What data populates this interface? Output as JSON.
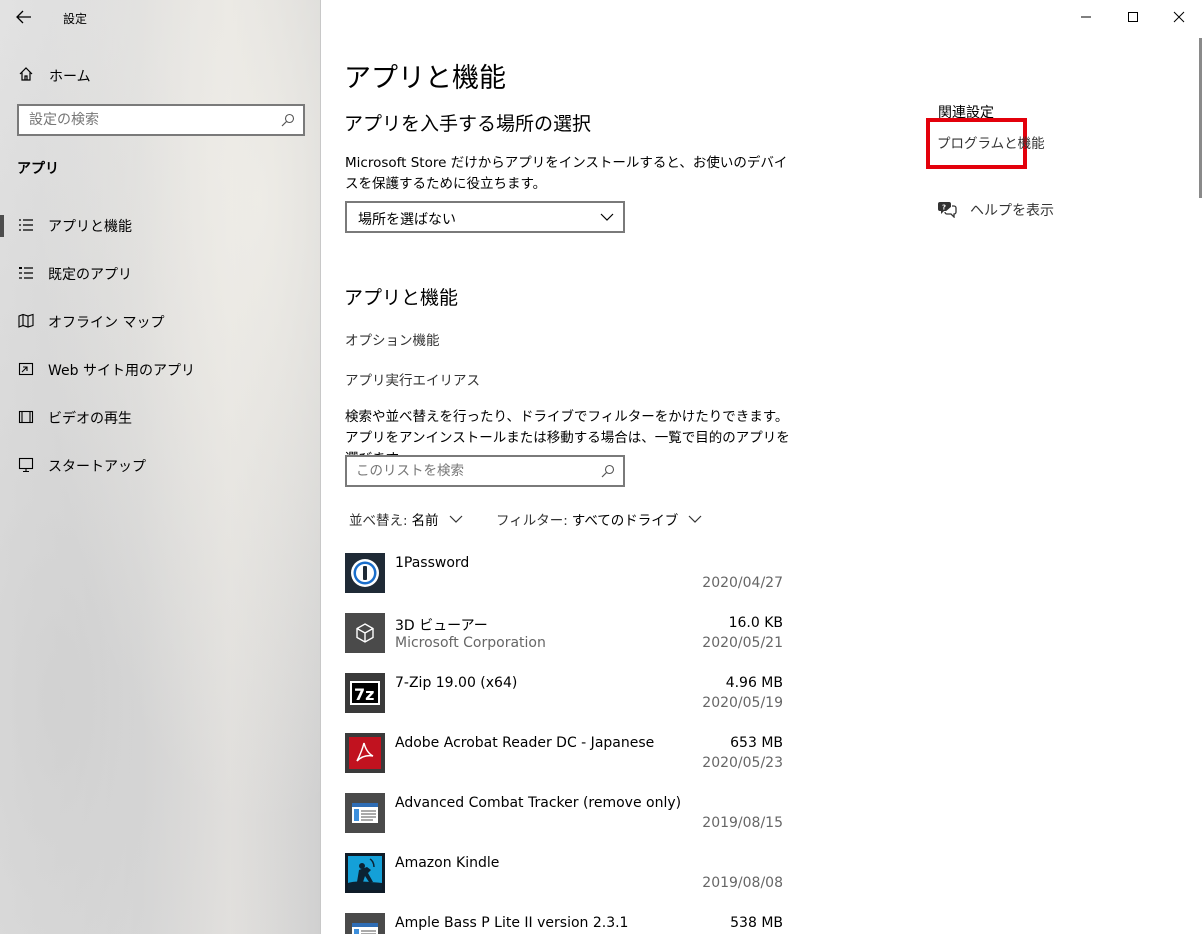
{
  "window": {
    "title": "設定"
  },
  "sidebar": {
    "home_label": "ホーム",
    "search_placeholder": "設定の検索",
    "section_label": "アプリ",
    "items": [
      {
        "label": "アプリと機能",
        "icon": "apps-features-icon",
        "active": true
      },
      {
        "label": "既定のアプリ",
        "icon": "default-apps-icon",
        "active": false
      },
      {
        "label": "オフライン マップ",
        "icon": "offline-maps-icon",
        "active": false
      },
      {
        "label": "Web サイト用のアプリ",
        "icon": "apps-for-websites-icon",
        "active": false
      },
      {
        "label": "ビデオの再生",
        "icon": "video-playback-icon",
        "active": false
      },
      {
        "label": "スタートアップ",
        "icon": "startup-icon",
        "active": false
      }
    ]
  },
  "main": {
    "page_title": "アプリと機能",
    "install_section": {
      "heading": "アプリを入手する場所の選択",
      "description": "Microsoft Store だけからアプリをインストールすると、お使いのデバイスを保護するために役立ちます。",
      "dropdown_value": "場所を選ばない"
    },
    "apps_section": {
      "heading": "アプリと機能",
      "optional_features": "オプション機能",
      "app_aliases": "アプリ実行エイリアス",
      "description": "検索や並べ替えを行ったり、ドライブでフィルターをかけたりできます。アプリをアンインストールまたは移動する場合は、一覧で目的のアプリを選びます。",
      "search_placeholder": "このリストを検索",
      "sort_label": "並べ替え:",
      "sort_value": "名前",
      "filter_label": "フィルター:",
      "filter_value": "すべてのドライブ"
    },
    "apps": [
      {
        "name": "1Password",
        "publisher": "",
        "size": "",
        "date": "2020/04/27",
        "icon": "1password-icon",
        "color": "#1a1a1a"
      },
      {
        "name": "3D ビューアー",
        "publisher": "Microsoft Corporation",
        "size": "16.0 KB",
        "date": "2020/05/21",
        "icon": "3d-viewer-icon",
        "color": "#4a4a4a"
      },
      {
        "name": "7-Zip 19.00 (x64)",
        "publisher": "",
        "size": "4.96 MB",
        "date": "2020/05/19",
        "icon": "7zip-icon",
        "color": "#111111"
      },
      {
        "name": "Adobe Acrobat Reader DC - Japanese",
        "publisher": "",
        "size": "653 MB",
        "date": "2020/05/23",
        "icon": "acrobat-icon",
        "color": "#c1121f"
      },
      {
        "name": "Advanced Combat Tracker (remove only)",
        "publisher": "",
        "size": "",
        "date": "2019/08/15",
        "icon": "program-icon",
        "color": "#4a4a4a"
      },
      {
        "name": "Amazon Kindle",
        "publisher": "",
        "size": "",
        "date": "2019/08/08",
        "icon": "kindle-icon",
        "color": "#1b2a3a"
      },
      {
        "name": "Ample Bass P Lite II version 2.3.1",
        "publisher": "",
        "size": "538 MB",
        "date": "",
        "icon": "program-icon",
        "color": "#4a4a4a"
      }
    ]
  },
  "related": {
    "title": "関連設定",
    "programs_link": "プログラムと機能",
    "help_label": "ヘルプを表示",
    "highlight_color": "#e3000b"
  }
}
